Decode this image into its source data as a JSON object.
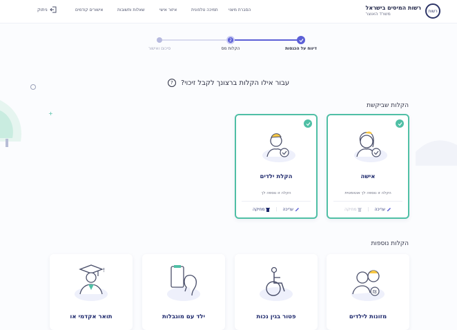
{
  "brand": {
    "title": "רשות המיסים בישראל",
    "subtitle": "משרד האוצר",
    "logo_text": "רשות"
  },
  "nav": {
    "items": [
      "הסברת מיצוי",
      "תמיכה טלפונית",
      "איזור אישי",
      "שאלות ותשובות",
      "אישורים קודמים"
    ],
    "logout": "ניתוק"
  },
  "stepper": {
    "steps": [
      {
        "label": "דיווח על הכנסות",
        "state": "done"
      },
      {
        "label": "הקלות מס",
        "state": "current",
        "number": "2"
      },
      {
        "label": "סיכום ואישור",
        "state": "upcoming"
      }
    ]
  },
  "question": {
    "text": "עבור אילו הקלות ברצונך לקבל זיכוי?",
    "help_icon": "?"
  },
  "requested": {
    "title": "הקלות שביקשת",
    "cards": [
      {
        "title": "אישה",
        "subtitle": "הקלה זו נוספה לך אוטומטית",
        "edit": "עריכה",
        "delete": "מחיקה",
        "icon": "woman-icon",
        "delete_disabled": true
      },
      {
        "title": "הקלת ילדים",
        "subtitle": "הקלה זו נוספה לך",
        "edit": "עריכה",
        "delete": "מחיקה",
        "icon": "child-icon",
        "delete_disabled": false
      }
    ]
  },
  "additional": {
    "title": "הקלות נוספות",
    "cards": [
      {
        "title": "מזונות לילדים",
        "icon": "alimony-icon"
      },
      {
        "title": "פטור בגין נכות",
        "icon": "wheelchair-icon"
      },
      {
        "title": "ילד עם מוגבלות",
        "icon": "child-disability-icon"
      },
      {
        "title": "תואר אקדמי או",
        "icon": "graduate-icon"
      }
    ]
  },
  "colors": {
    "accent": "#5b5fd6",
    "selected_border": "#4fbfa5",
    "navy": "#1f2a6d"
  }
}
